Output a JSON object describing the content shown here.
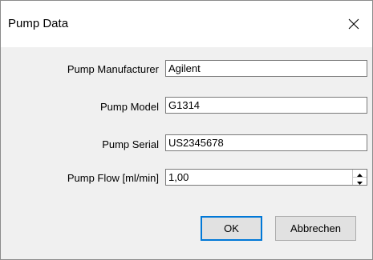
{
  "window": {
    "title": "Pump Data",
    "close_icon": "close-icon"
  },
  "fields": {
    "manufacturer": {
      "label": "Pump Manufacturer",
      "value": "Agilent"
    },
    "model": {
      "label": "Pump Model",
      "value": "G1314"
    },
    "serial": {
      "label": "Pump Serial",
      "value": "US2345678"
    },
    "flow": {
      "label": "Pump Flow [ml/min]",
      "value": "1,00"
    }
  },
  "buttons": {
    "ok_label": "OK",
    "cancel_label": "Abbrechen"
  },
  "colors": {
    "default_button_border": "#0078d7",
    "dialog_background": "#f0f0f0"
  }
}
